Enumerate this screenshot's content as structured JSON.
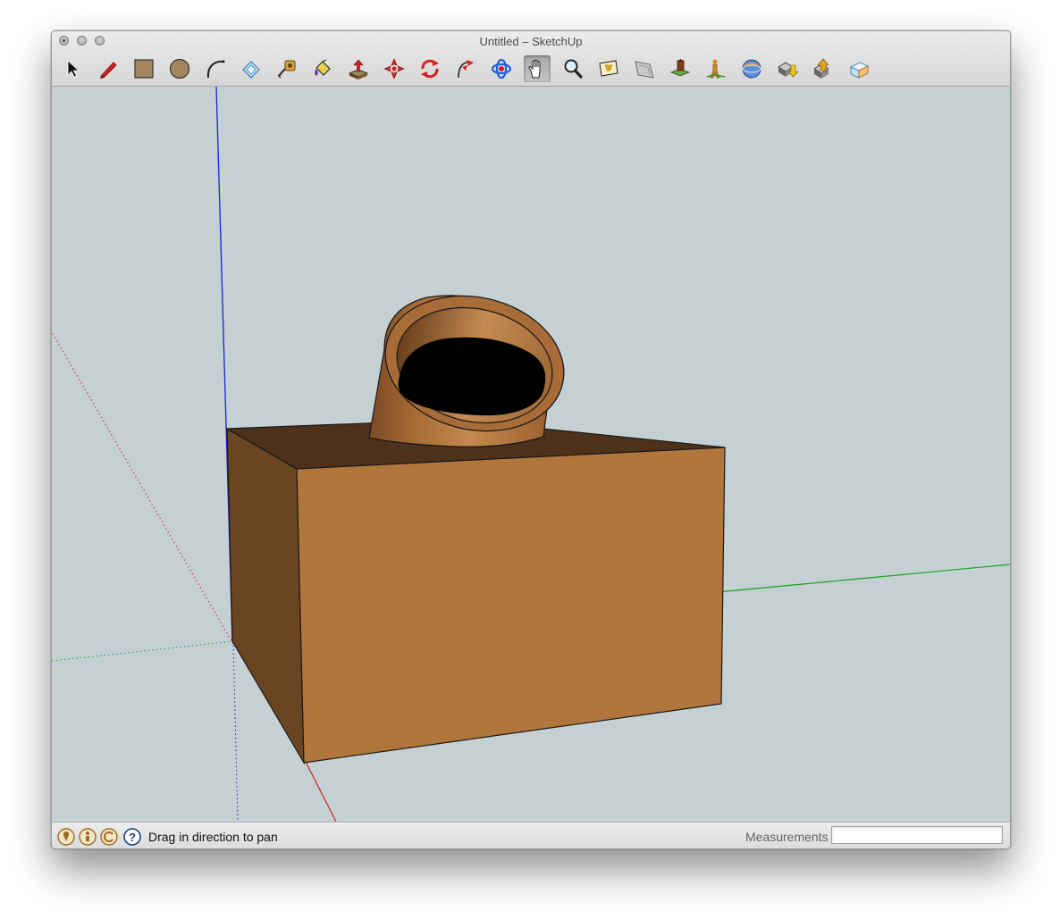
{
  "window": {
    "title": "Untitled – SketchUp"
  },
  "toolbar": {
    "tools": [
      {
        "name": "select-icon",
        "label": "Select"
      },
      {
        "name": "pencil-icon",
        "label": "Line"
      },
      {
        "name": "rectangle-icon",
        "label": "Rectangle"
      },
      {
        "name": "circle-icon",
        "label": "Circle"
      },
      {
        "name": "arc-icon",
        "label": "Arc"
      },
      {
        "name": "eraser-icon",
        "label": "Eraser"
      },
      {
        "name": "tape-measure-icon",
        "label": "Tape Measure"
      },
      {
        "name": "paint-bucket-icon",
        "label": "Paint Bucket"
      },
      {
        "name": "push-pull-icon",
        "label": "Push/Pull"
      },
      {
        "name": "move-icon",
        "label": "Move"
      },
      {
        "name": "rotate-icon",
        "label": "Rotate"
      },
      {
        "name": "follow-me-icon",
        "label": "Follow Me"
      },
      {
        "name": "orbit-icon",
        "label": "Orbit"
      },
      {
        "name": "pan-hand-icon",
        "label": "Pan",
        "active": true
      },
      {
        "name": "zoom-icon",
        "label": "Zoom"
      },
      {
        "name": "zoom-extents-icon",
        "label": "Zoom Extents"
      },
      {
        "name": "previous-view-icon",
        "label": "Previous View"
      },
      {
        "name": "add-location-icon",
        "label": "Add Location"
      },
      {
        "name": "position-camera-icon",
        "label": "Position Camera"
      },
      {
        "name": "3d-warehouse-icon",
        "label": "3D Warehouse"
      },
      {
        "name": "get-models-icon",
        "label": "Get Models"
      },
      {
        "name": "share-model-icon",
        "label": "Share Model"
      },
      {
        "name": "layout-icon",
        "label": "Send to LayOut"
      }
    ]
  },
  "colors": {
    "background": "#c5d0d3",
    "box_front": "#b0763b",
    "box_side": "#6a4522",
    "box_top": "#4e311a",
    "pipe": "#a56a36",
    "axis_red": "#d42020",
    "axis_green": "#22a022",
    "axis_blue": "#2020d8"
  },
  "statusbar": {
    "icons": [
      "geo-location-icon",
      "credits-icon",
      "license-icon",
      "help-icon"
    ],
    "message": "Drag in direction to pan",
    "measurements_label": "Measurements",
    "measurements_value": ""
  }
}
